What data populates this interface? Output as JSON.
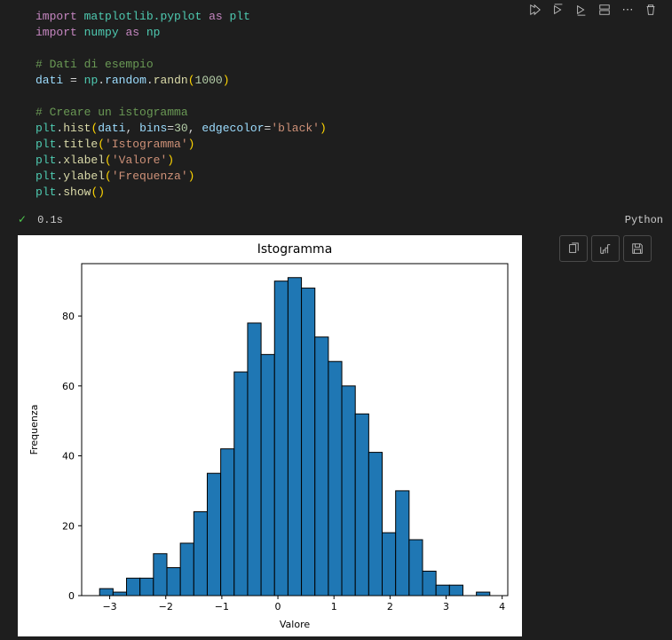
{
  "code": {
    "line1": {
      "import": "import",
      "module": "matplotlib.pyplot",
      "as": "as",
      "alias": "plt"
    },
    "line2": {
      "import": "import",
      "module": "numpy",
      "as": "as",
      "alias": "np"
    },
    "line4_comment": "# Dati di esempio",
    "line5": {
      "var": "dati",
      "eq": "=",
      "np": "np",
      "random": "random",
      "randn": "randn",
      "arg": "1000"
    },
    "line7_comment": "# Creare un istogramma",
    "line8": {
      "plt": "plt",
      "fn": "hist",
      "arg_v": "dati",
      "bins_kw": "bins",
      "bins_v": "30",
      "edge_kw": "edgecolor",
      "edge_v": "'black'"
    },
    "line9": {
      "plt": "plt",
      "fn": "title",
      "arg": "'Istogramma'"
    },
    "line10": {
      "plt": "plt",
      "fn": "xlabel",
      "arg": "'Valore'"
    },
    "line11": {
      "plt": "plt",
      "fn": "ylabel",
      "arg": "'Frequenza'"
    },
    "line12": {
      "plt": "plt",
      "fn": "show"
    }
  },
  "status": {
    "check": "✓",
    "time": "0.1s",
    "lang": "Python"
  },
  "chart_data": {
    "type": "bar",
    "title": "Istogramma",
    "xlabel": "Valore",
    "ylabel": "Frequenza",
    "xlim": [
      -3.5,
      4.1
    ],
    "ylim": [
      0,
      95
    ],
    "xticks": [
      -3,
      -2,
      -1,
      0,
      1,
      2,
      3,
      4
    ],
    "yticks": [
      0,
      20,
      40,
      60,
      80
    ],
    "bin_width": 0.24,
    "bins": [
      {
        "x": -3.18,
        "y": 2
      },
      {
        "x": -2.94,
        "y": 1
      },
      {
        "x": -2.7,
        "y": 5
      },
      {
        "x": -2.46,
        "y": 5
      },
      {
        "x": -2.22,
        "y": 12
      },
      {
        "x": -1.98,
        "y": 8
      },
      {
        "x": -1.74,
        "y": 15
      },
      {
        "x": -1.5,
        "y": 24
      },
      {
        "x": -1.26,
        "y": 35
      },
      {
        "x": -1.02,
        "y": 42
      },
      {
        "x": -0.78,
        "y": 64
      },
      {
        "x": -0.54,
        "y": 78
      },
      {
        "x": -0.3,
        "y": 69
      },
      {
        "x": -0.06,
        "y": 90
      },
      {
        "x": 0.18,
        "y": 91
      },
      {
        "x": 0.42,
        "y": 88
      },
      {
        "x": 0.66,
        "y": 74
      },
      {
        "x": 0.9,
        "y": 67
      },
      {
        "x": 1.14,
        "y": 60
      },
      {
        "x": 1.38,
        "y": 52
      },
      {
        "x": 1.62,
        "y": 41
      },
      {
        "x": 1.86,
        "y": 18
      },
      {
        "x": 2.1,
        "y": 30
      },
      {
        "x": 2.34,
        "y": 16
      },
      {
        "x": 2.58,
        "y": 7
      },
      {
        "x": 2.82,
        "y": 3
      },
      {
        "x": 3.06,
        "y": 3
      },
      {
        "x": 3.3,
        "y": 0
      },
      {
        "x": 3.54,
        "y": 1
      },
      {
        "x": 3.78,
        "y": 0
      }
    ]
  }
}
